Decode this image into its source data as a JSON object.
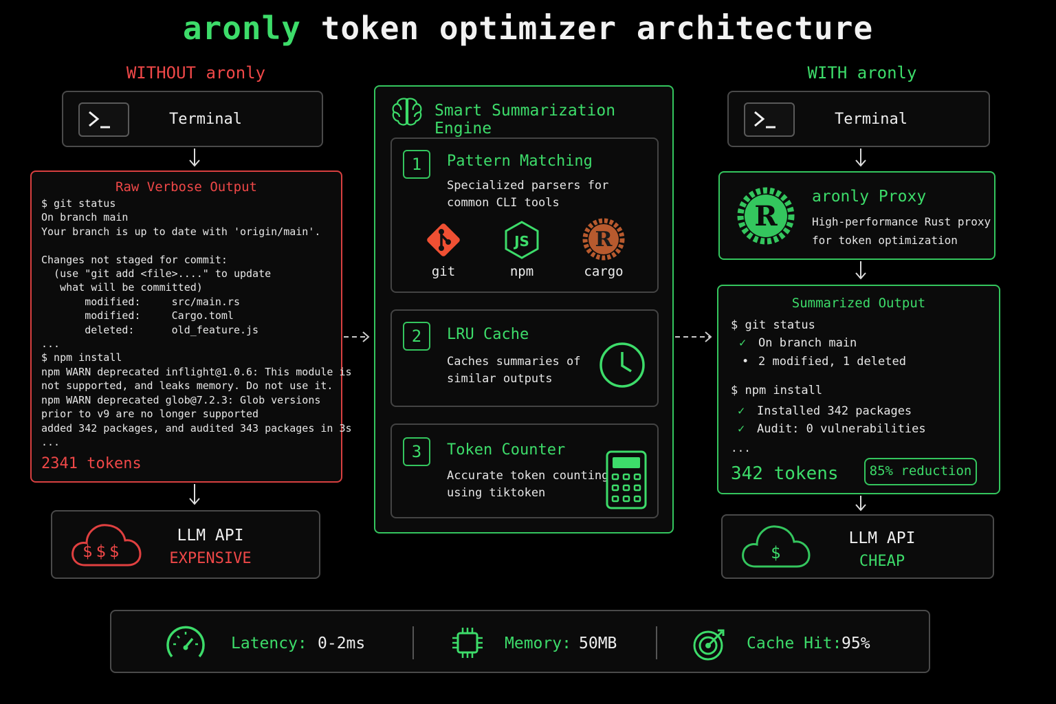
{
  "title": {
    "brand": "aronly",
    "rest": "token optimizer architecture"
  },
  "left": {
    "heading": "WITHOUT aronly",
    "terminal_label": "Terminal",
    "raw_title": "Raw Verbose Output",
    "raw_lines": [
      "$ git status",
      "On branch main",
      "Your branch is up to date with 'origin/main'.",
      "",
      "Changes not staged for commit:",
      "  (use \"git add <file>....\" to update",
      "   what will be committed)",
      "       modified:     src/main.rs",
      "       modified:     Cargo.toml",
      "       deleted:      old_feature.js",
      "...",
      "$ npm install",
      "npm WARN deprecated inflight@1.0.6: This module is",
      "not supported, and leaks memory. Do not use it.",
      "npm WARN deprecated glob@7.2.3: Glob versions",
      "prior to v9 are no longer supported",
      "added 342 packages, and audited 343 packages in 3s",
      "..."
    ],
    "tokens": "2341 tokens",
    "api_label": "LLM API",
    "api_status": "EXPENSIVE",
    "cloud_text": "$$$"
  },
  "center": {
    "title": "Smart Summarization Engine",
    "steps": [
      {
        "num": "1",
        "title": "Pattern Matching",
        "desc": "Specialized parsers for\ncommon CLI tools"
      },
      {
        "num": "2",
        "title": "LRU Cache",
        "desc": "Caches summaries of\nsimilar outputs"
      },
      {
        "num": "3",
        "title": "Token Counter",
        "desc": "Accurate token counting\nusing tiktoken"
      }
    ],
    "tools": [
      "git",
      "npm",
      "cargo"
    ]
  },
  "right": {
    "heading": "WITH aronly",
    "terminal_label": "Terminal",
    "proxy_title": "aronly Proxy",
    "proxy_desc": "High-performance Rust proxy\nfor token optimization",
    "summary_title": "Summarized Output",
    "summary": {
      "cmd1": "$ git status",
      "line1": "On branch main",
      "line2": "2 modified, 1 deleted",
      "cmd2": "$ npm install",
      "line3": "Installed 342 packages",
      "line4": "Audit: 0 vulnerabilities",
      "ellipsis": "..."
    },
    "tokens": "342 tokens",
    "reduction": "85% reduction",
    "api_label": "LLM API",
    "api_status": "CHEAP",
    "cloud_text": "$"
  },
  "stats": [
    {
      "label": "Latency:",
      "value": "0-2ms",
      "icon": "speedometer-icon"
    },
    {
      "label": "Memory:",
      "value": "50MB",
      "icon": "chip-icon"
    },
    {
      "label": "Cache Hit:",
      "value": "95%",
      "icon": "target-icon"
    }
  ],
  "colors": {
    "green": "#3ddc6a",
    "red": "#f04848",
    "rust": "#b85a2e",
    "git": "#f05033"
  }
}
